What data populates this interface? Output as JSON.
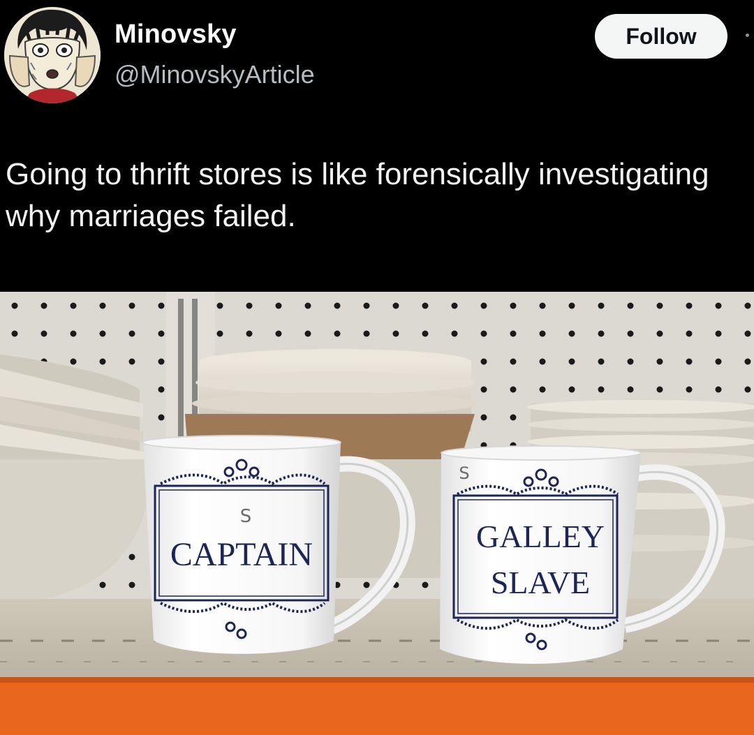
{
  "tweet": {
    "author": {
      "display_name": "Minovsky",
      "handle": "@MinovskyArticle",
      "avatar_icon": "anime-portrait-avatar"
    },
    "follow_label": "Follow",
    "text": "Going to thrift stores is like forensically investigating why marriages failed."
  },
  "photo": {
    "mugs": [
      {
        "lines": [
          "CAPTAIN"
        ],
        "price_mark": "S"
      },
      {
        "lines": [
          "GALLEY",
          "SLAVE"
        ],
        "price_mark": "S"
      }
    ]
  },
  "colors": {
    "background": "#000000",
    "follow_button_bg": "#f4f5f5",
    "handle_text": "#b7bcc2",
    "mug_ink": "#1c2556",
    "shelf_orange": "#e8671c"
  }
}
